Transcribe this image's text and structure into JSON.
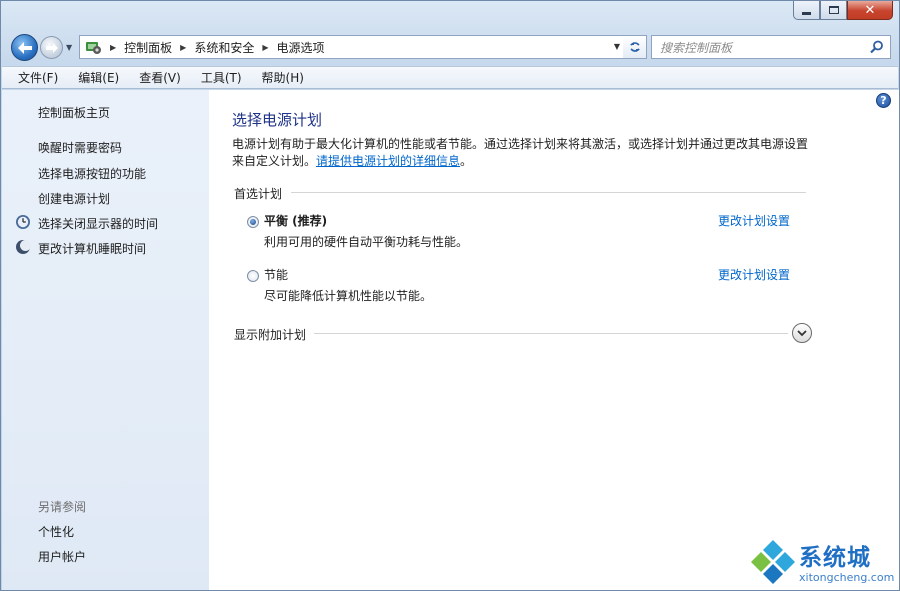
{
  "window": {
    "caption": {
      "minimize": "minimize",
      "maximize": "maximize",
      "close": "close"
    }
  },
  "address": {
    "crumbs": [
      "控制面板",
      "系统和安全",
      "电源选项"
    ],
    "search_placeholder": "搜索控制面板"
  },
  "menu": {
    "items": [
      "文件(F)",
      "编辑(E)",
      "查看(V)",
      "工具(T)",
      "帮助(H)"
    ]
  },
  "sidebar": {
    "home": "控制面板主页",
    "links": [
      "唤醒时需要密码",
      "选择电源按钮的功能",
      "创建电源计划",
      "选择关闭显示器的时间",
      "更改计算机睡眠时间"
    ],
    "see_also_title": "另请参阅",
    "see_also": [
      "个性化",
      "用户帐户"
    ]
  },
  "main": {
    "title": "选择电源计划",
    "desc_text": "电源计划有助于最大化计算机的性能或者节能。通过选择计划来将其激活，或选择计划并通过更改其电源设置来自定义计划。",
    "desc_link": "请提供电源计划的详细信息",
    "desc_end": "。",
    "preferred_title": "首选计划",
    "plans": [
      {
        "name": "平衡 (推荐)",
        "desc": "利用可用的硬件自动平衡功耗与性能。",
        "link": "更改计划设置",
        "selected": true
      },
      {
        "name": "节能",
        "desc": "尽可能降低计算机性能以节能。",
        "link": "更改计划设置",
        "selected": false
      }
    ],
    "extra_title": "显示附加计划",
    "help": "?"
  },
  "watermark": {
    "name": "系统城",
    "url": "xitongcheng.com"
  },
  "colors": {
    "accent_blue": "#1e3287",
    "link": "#0066cc"
  }
}
